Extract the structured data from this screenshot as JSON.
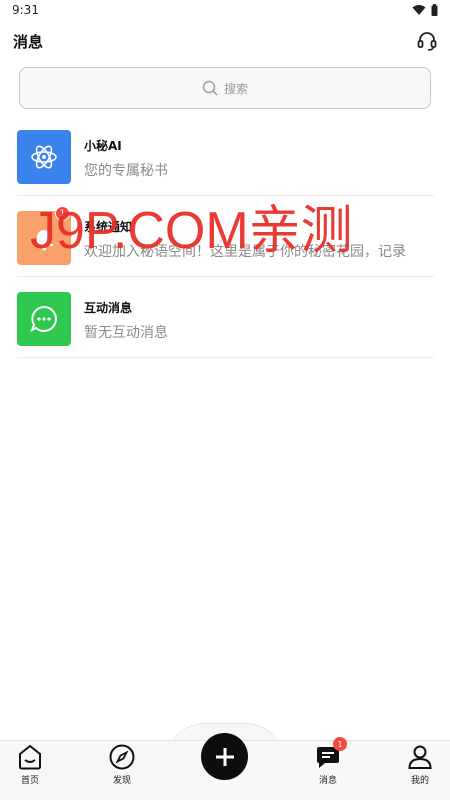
{
  "status_bar": {
    "time": "9:31",
    "wifi_icon": "wifi-icon",
    "battery_icon": "battery-icon"
  },
  "header": {
    "title": "消息",
    "support_icon": "headset-icon"
  },
  "search": {
    "placeholder": "搜索",
    "icon": "search-icon"
  },
  "messages": [
    {
      "name": "小秘AI",
      "preview": "您的专属秘书",
      "icon": "atom-icon",
      "color": "#3a82ec"
    },
    {
      "name": "系统通知",
      "preview": "欢迎加入秘语空间！这里是属于你的秘密花园，记录",
      "icon": "bell-icon",
      "color": "#f9a06b",
      "badge": "1"
    },
    {
      "name": "互动消息",
      "preview": "暂无互动消息",
      "icon": "chat-bubble-icon",
      "color": "#2dc84d"
    }
  ],
  "watermark": "J9P.COM亲测",
  "bottom_nav": {
    "items": [
      {
        "label": "首页",
        "icon": "home-icon"
      },
      {
        "label": "发现",
        "icon": "compass-icon"
      },
      {
        "label": "消息",
        "icon": "message-icon",
        "badge": "1",
        "active": true
      },
      {
        "label": "我的",
        "icon": "user-icon"
      }
    ],
    "plus_icon": "plus-icon"
  }
}
